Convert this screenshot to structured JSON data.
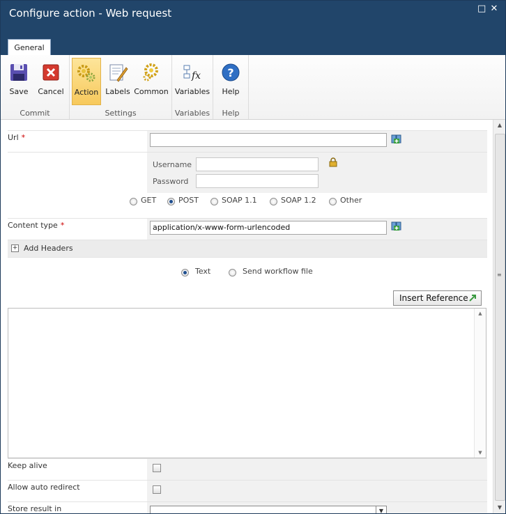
{
  "window": {
    "title": "Configure action - Web request",
    "maximize_glyph": "□",
    "close_glyph": "✕"
  },
  "tabs": [
    {
      "label": "General"
    }
  ],
  "ribbon": {
    "groups": [
      {
        "label": "Commit",
        "buttons": [
          {
            "label": "Save",
            "icon": "save-icon"
          },
          {
            "label": "Cancel",
            "icon": "cancel-icon"
          }
        ]
      },
      {
        "label": "Settings",
        "buttons": [
          {
            "label": "Action",
            "icon": "gears-icon",
            "active": true
          },
          {
            "label": "Labels",
            "icon": "labels-icon"
          },
          {
            "label": "Common",
            "icon": "gear-icon"
          }
        ]
      },
      {
        "label": "Variables",
        "buttons": [
          {
            "label": "Variables",
            "icon": "variables-icon"
          }
        ]
      },
      {
        "label": "Help",
        "buttons": [
          {
            "label": "Help",
            "icon": "help-icon"
          }
        ]
      }
    ]
  },
  "form": {
    "url": {
      "label": "Url",
      "required": "*",
      "value": ""
    },
    "credentials": {
      "username_label": "Username",
      "password_label": "Password",
      "username_value": "",
      "password_value": "",
      "lock_icon": "lock-icon"
    },
    "method": {
      "options": [
        "GET",
        "POST",
        "SOAP 1.1",
        "SOAP 1.2",
        "Other"
      ],
      "selected": "POST"
    },
    "content_type": {
      "label": "Content type",
      "required": "*",
      "value": "application/x-www-form-urlencoded"
    },
    "add_headers": {
      "label": "Add Headers",
      "toggle_glyph": "+"
    },
    "body_mode": {
      "options": [
        "Text",
        "Send workflow file"
      ],
      "selected": "Text"
    },
    "insert_reference": {
      "label": "Insert Reference"
    },
    "body_text": "",
    "keep_alive": {
      "label": "Keep alive",
      "checked": false
    },
    "allow_auto_redirect": {
      "label": "Allow auto redirect",
      "checked": false
    },
    "store_result": {
      "label": "Store result in",
      "value": ""
    }
  },
  "colors": {
    "titlebar": "#21456a",
    "active_button": "#f7c95c",
    "required": "#cc0000"
  }
}
